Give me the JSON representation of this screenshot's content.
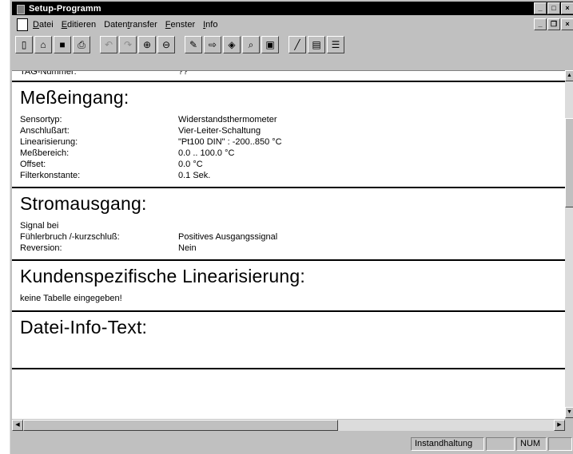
{
  "window": {
    "title": "Setup-Programm"
  },
  "menu": {
    "items": [
      "Datei",
      "Editieren",
      "Datentransfer",
      "Fenster",
      "Info"
    ],
    "underline_chars": [
      "D",
      "E",
      "t",
      "F",
      "I"
    ]
  },
  "toolbar": {
    "buttons": [
      {
        "icon": "new-document-icon",
        "glyph": "▯",
        "enabled": true
      },
      {
        "icon": "open-folder-icon",
        "glyph": "⌂",
        "enabled": true
      },
      {
        "icon": "save-icon",
        "glyph": "■",
        "enabled": true
      },
      {
        "icon": "print-icon",
        "glyph": "⎙",
        "enabled": true
      },
      {
        "icon": "undo-icon",
        "glyph": "↶",
        "enabled": false
      },
      {
        "icon": "redo-icon",
        "glyph": "↷",
        "enabled": false
      },
      {
        "icon": "target-icon",
        "glyph": "⊕",
        "enabled": true
      },
      {
        "icon": "transfer-icon",
        "glyph": "⊖",
        "enabled": true
      },
      {
        "icon": "pen-icon",
        "glyph": "✎",
        "enabled": true
      },
      {
        "icon": "arrow-right-icon",
        "glyph": "⇨",
        "enabled": true
      },
      {
        "icon": "diamond-icon",
        "glyph": "◈",
        "enabled": true
      },
      {
        "icon": "zoom-icon",
        "glyph": "⌕",
        "enabled": true
      },
      {
        "icon": "picture-icon",
        "glyph": "▣",
        "enabled": true
      },
      {
        "icon": "line-icon",
        "glyph": "╱",
        "enabled": true
      },
      {
        "icon": "grid-icon",
        "glyph": "▤",
        "enabled": true
      },
      {
        "icon": "list-icon",
        "glyph": "☰",
        "enabled": true
      }
    ]
  },
  "content": {
    "tag_label": "TAG-Nummer:",
    "tag_value": "??",
    "sections": [
      {
        "heading": "Meßeingang:",
        "rows": [
          {
            "label": "Sensortyp:",
            "value": "Widerstandsthermometer"
          },
          {
            "label": "Anschlußart:",
            "value": "Vier-Leiter-Schaltung"
          },
          {
            "label": "Linearisierung:",
            "value": "\"Pt100 DIN\" : -200..850 °C"
          },
          {
            "label": "Meßbereich:",
            "value": "0.0 .. 100.0 °C"
          },
          {
            "label": "Offset:",
            "value": "0.0 °C"
          },
          {
            "label": "Filterkonstante:",
            "value": "0.1 Sek."
          }
        ]
      },
      {
        "heading": "Stromausgang:",
        "rows": [
          {
            "label": "Signal bei",
            "value": ""
          },
          {
            "label": "Fühlerbruch /-kurzschluß:",
            "value": "Positives Ausgangssignal"
          },
          {
            "label": "Reversion:",
            "value": "Nein"
          }
        ]
      },
      {
        "heading": "Kundenspezifische Linearisierung:",
        "rows": [
          {
            "label": "keine Tabelle eingegeben!",
            "value": ""
          }
        ]
      },
      {
        "heading": "Datei-Info-Text:",
        "rows": []
      }
    ]
  },
  "status": {
    "mode": "Instandhaltung",
    "blank": "",
    "num": "NUM"
  }
}
